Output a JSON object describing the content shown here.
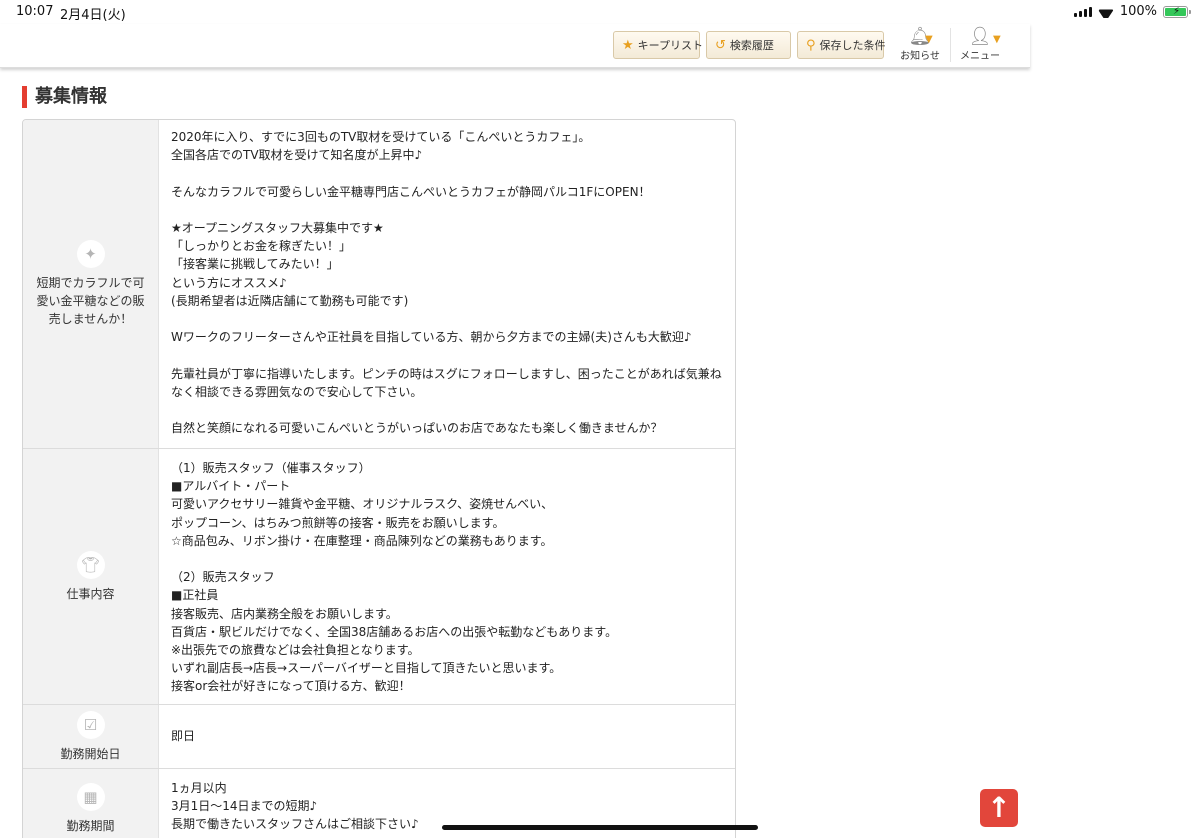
{
  "status_bar": {
    "time": "10:07",
    "date": "2月4日(火)",
    "battery": "100%",
    "battery_level": 1.0
  },
  "header": {
    "buttons": [
      {
        "label": "キープリスト",
        "icon": "star-icon"
      },
      {
        "label": "検索履歴",
        "icon": "history-icon"
      },
      {
        "label": "保存した条件",
        "icon": "search-icon"
      }
    ],
    "notifications_label": "お知らせ",
    "menu_label": "メニュー"
  },
  "section_title": "募集情報",
  "rows": [
    {
      "label": "短期でカラフルで可愛い金平糖などの販売しませんか！",
      "icon": "sparkle-icon",
      "lines": [
        "2020年に入り、すでに3回ものTV取材を受けている「こんぺいとうカフェ」。",
        "全国各店でのTV取材を受けて知名度が上昇中♪",
        "",
        "そんなカラフルで可愛らしい金平糖専門店こんぺいとうカフェが静岡パルコ1FにOPEN！",
        "",
        "★オープニングスタッフ大募集中です★",
        "「しっかりとお金を稼ぎたい！」",
        "「接客業に挑戦してみたい！」",
        "という方にオススメ♪",
        "(長期希望者は近隣店舗にて勤務も可能です)",
        "",
        "Wワークのフリーターさんや正社員を目指している方、朝から夕方までの主婦(夫)さんも大歓迎♪",
        "",
        "先輩社員が丁寧に指導いたします。ピンチの時はスグにフォローしますし、困ったことがあれば気兼ね",
        "なく相談できる雰囲気なので安心して下さい。",
        "",
        "自然と笑顔になれる可愛いこんぺいとうがいっぱいのお店であなたも楽しく働きませんか？"
      ]
    },
    {
      "label": "仕事内容",
      "icon": "shirt-icon",
      "lines": [
        "（1）販売スタッフ（催事スタッフ）",
        "■アルバイト・パート",
        "可愛いアクセサリー雑貨や金平糖、オリジナルラスク、姿焼せんべい、",
        "ポップコーン、はちみつ煎餅等の接客・販売をお願いします。",
        "☆商品包み、リボン掛け・在庫整理・商品陳列などの業務もあります。",
        "",
        "（2）販売スタッフ",
        "■正社員",
        "接客販売、店内業務全般をお願いします。",
        "百貨店・駅ビルだけでなく、全国38店舗あるお店への出張や転勤などもあります。",
        "※出張先での旅費などは会社負担となります。",
        "いずれ副店長→店長→スーパーバイザーと目指して頂きたいと思います。",
        "接客or会社が好きになって頂ける方、歓迎！"
      ]
    },
    {
      "label": "勤務開始日",
      "icon": "calendar-check-icon",
      "lines": [
        "即日"
      ]
    },
    {
      "label": "勤務期間",
      "icon": "calendar-icon",
      "lines": [
        "1ヵ月以内",
        "3月1日〜14日までの短期♪",
        "長期で働きたいスタッフさんはご相談下さい♪"
      ]
    }
  ],
  "scroll_top_icon": "arrow-up-icon"
}
